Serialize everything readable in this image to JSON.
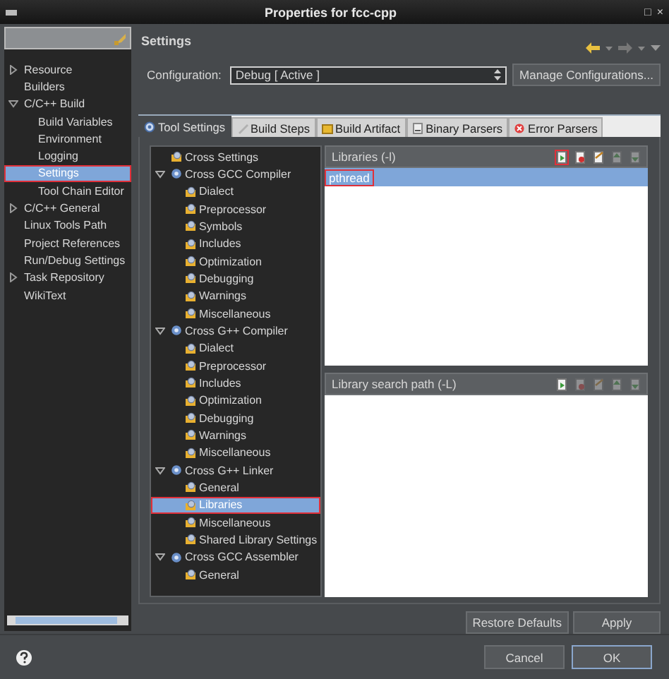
{
  "window": {
    "title": "Properties for fcc-cpp",
    "controls": [
      "□",
      "×"
    ]
  },
  "sidebar": {
    "items": [
      {
        "label": "Resource",
        "expanded": false,
        "selected": false,
        "highlighted": false
      },
      {
        "label": "Builders",
        "selected": false,
        "highlighted": false
      },
      {
        "label": "C/C++ Build",
        "expanded": true,
        "selected": false,
        "highlighted": false,
        "children": [
          {
            "label": "Build Variables",
            "selected": false,
            "highlighted": false
          },
          {
            "label": "Environment",
            "selected": false,
            "highlighted": false
          },
          {
            "label": "Logging",
            "selected": false,
            "highlighted": false
          },
          {
            "label": "Settings",
            "selected": true,
            "highlighted": true
          },
          {
            "label": "Tool Chain Editor",
            "selected": false,
            "highlighted": false
          }
        ]
      },
      {
        "label": "C/C++ General",
        "expanded": false,
        "selected": false,
        "highlighted": false
      },
      {
        "label": "Linux Tools Path",
        "selected": false,
        "highlighted": false
      },
      {
        "label": "Project References",
        "selected": false,
        "highlighted": false
      },
      {
        "label": "Run/Debug Settings",
        "selected": false,
        "highlighted": false
      },
      {
        "label": "Task Repository",
        "expanded": false,
        "selected": false,
        "highlighted": false
      },
      {
        "label": "WikiText",
        "selected": false,
        "highlighted": false
      }
    ]
  },
  "page": {
    "title": "Settings"
  },
  "configuration": {
    "label": "Configuration:",
    "value": "Debug  [ Active ]",
    "button": "Manage Configurations..."
  },
  "tabs": [
    {
      "label": "Tool Settings",
      "selected": true
    },
    {
      "label": "Build Steps",
      "selected": false
    },
    {
      "label": "Build Artifact",
      "selected": false
    },
    {
      "label": "Binary Parsers",
      "selected": false
    },
    {
      "label": "Error Parsers",
      "selected": false
    }
  ],
  "tool_tree": [
    {
      "label": "Cross Settings",
      "kind": "option",
      "selected": false,
      "highlighted": false
    },
    {
      "label": "Cross GCC Compiler",
      "kind": "tool",
      "expanded": true,
      "selected": false,
      "highlighted": false,
      "children": [
        {
          "label": "Dialect",
          "kind": "option",
          "selected": false,
          "highlighted": false
        },
        {
          "label": "Preprocessor",
          "kind": "option",
          "selected": false,
          "highlighted": false
        },
        {
          "label": "Symbols",
          "kind": "option",
          "selected": false,
          "highlighted": false
        },
        {
          "label": "Includes",
          "kind": "option",
          "selected": false,
          "highlighted": false
        },
        {
          "label": "Optimization",
          "kind": "option",
          "selected": false,
          "highlighted": false
        },
        {
          "label": "Debugging",
          "kind": "option",
          "selected": false,
          "highlighted": false
        },
        {
          "label": "Warnings",
          "kind": "option",
          "selected": false,
          "highlighted": false
        },
        {
          "label": "Miscellaneous",
          "kind": "option",
          "selected": false,
          "highlighted": false
        }
      ]
    },
    {
      "label": "Cross G++ Compiler",
      "kind": "tool",
      "expanded": true,
      "selected": false,
      "highlighted": false,
      "children": [
        {
          "label": "Dialect",
          "kind": "option",
          "selected": false,
          "highlighted": false
        },
        {
          "label": "Preprocessor",
          "kind": "option",
          "selected": false,
          "highlighted": false
        },
        {
          "label": "Includes",
          "kind": "option",
          "selected": false,
          "highlighted": false
        },
        {
          "label": "Optimization",
          "kind": "option",
          "selected": false,
          "highlighted": false
        },
        {
          "label": "Debugging",
          "kind": "option",
          "selected": false,
          "highlighted": false
        },
        {
          "label": "Warnings",
          "kind": "option",
          "selected": false,
          "highlighted": false
        },
        {
          "label": "Miscellaneous",
          "kind": "option",
          "selected": false,
          "highlighted": false
        }
      ]
    },
    {
      "label": "Cross G++ Linker",
      "kind": "tool",
      "expanded": true,
      "selected": false,
      "highlighted": false,
      "children": [
        {
          "label": "General",
          "kind": "option",
          "selected": false,
          "highlighted": false
        },
        {
          "label": "Libraries",
          "kind": "option",
          "selected": true,
          "highlighted": true
        },
        {
          "label": "Miscellaneous",
          "kind": "option",
          "selected": false,
          "highlighted": false
        },
        {
          "label": "Shared Library Settings",
          "kind": "option",
          "selected": false,
          "highlighted": false
        }
      ]
    },
    {
      "label": "Cross GCC Assembler",
      "kind": "tool",
      "expanded": true,
      "selected": false,
      "highlighted": false,
      "children": [
        {
          "label": "General",
          "kind": "option",
          "selected": false,
          "highlighted": false
        }
      ]
    }
  ],
  "lists": [
    {
      "title": "Libraries (-l)",
      "tools": [
        {
          "disabled": false,
          "highlighted": true
        },
        {
          "disabled": false,
          "highlighted": false
        },
        {
          "disabled": false,
          "highlighted": false
        },
        {
          "disabled": true,
          "highlighted": false
        },
        {
          "disabled": true,
          "highlighted": false
        }
      ],
      "items": [
        {
          "text": "pthread",
          "selected": true,
          "highlighted": true
        }
      ]
    },
    {
      "title": "Library search path (-L)",
      "tools": [
        {
          "disabled": false,
          "highlighted": false
        },
        {
          "disabled": true,
          "highlighted": false
        },
        {
          "disabled": true,
          "highlighted": false
        },
        {
          "disabled": true,
          "highlighted": false
        },
        {
          "disabled": true,
          "highlighted": false
        }
      ]
    }
  ],
  "page_buttons": [
    "Restore Defaults",
    "Apply"
  ],
  "dialog_buttons": [
    "Cancel",
    "OK"
  ]
}
